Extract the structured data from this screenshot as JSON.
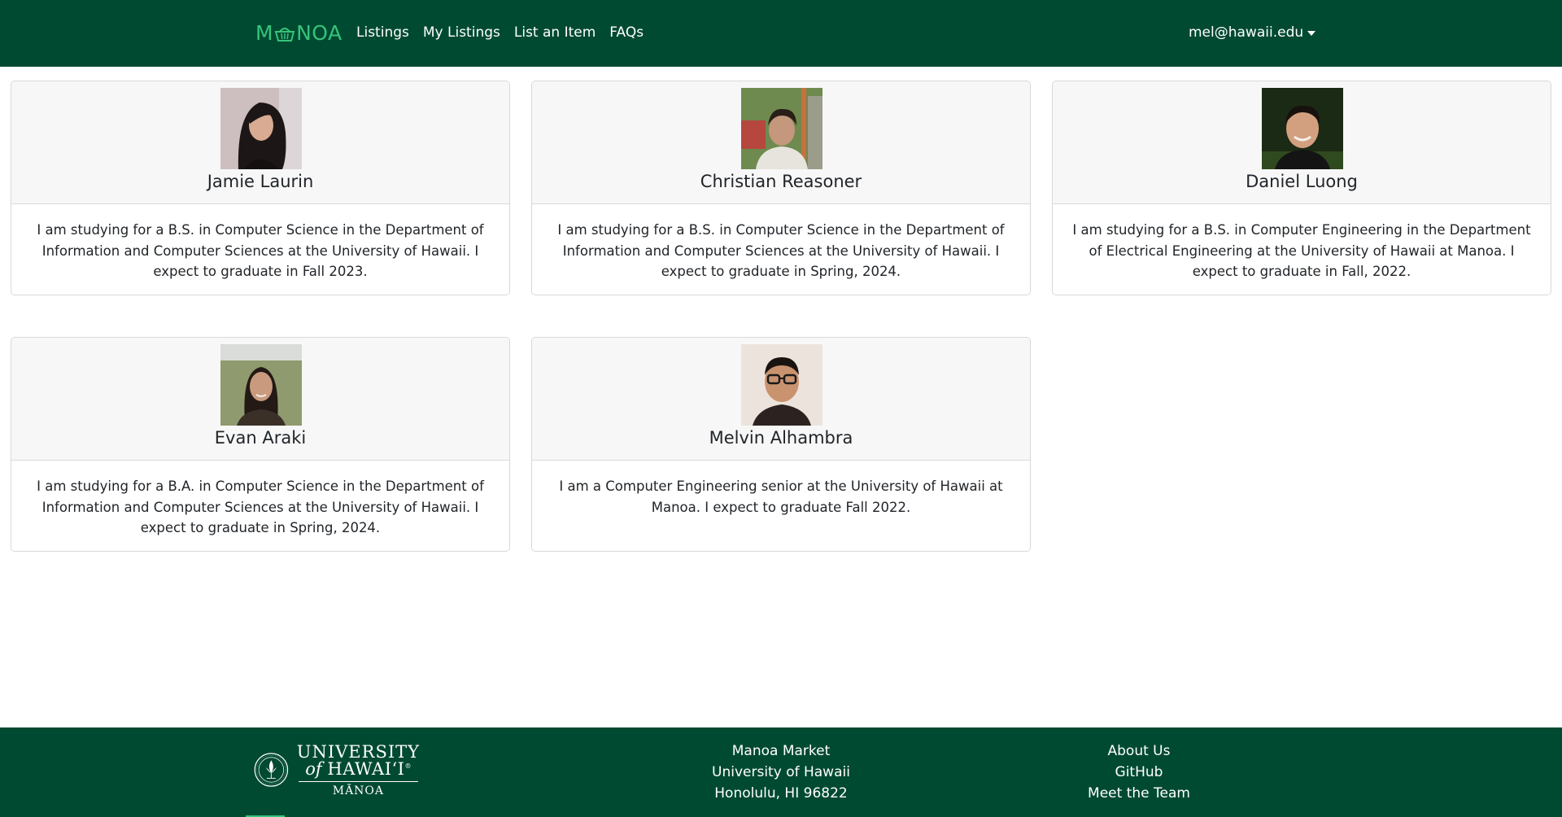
{
  "navbar": {
    "brand_left": "M",
    "brand_right": "NOA",
    "brand_icon": "basket-icon",
    "links": [
      "Listings",
      "My Listings",
      "List an Item",
      "FAQs"
    ],
    "user_email": "mel@hawaii.edu",
    "brand_color": "#35c47a",
    "background_color": "#004a31"
  },
  "team": [
    {
      "name": "Jamie Laurin",
      "bio": "I am studying for a B.S. in Computer Science in the Department of Information and Computer Sciences at the University of Hawaii. I expect to graduate in Fall 2023."
    },
    {
      "name": "Christian Reasoner",
      "bio": "I am studying for a B.S. in Computer Science in the Department of Information and Computer Sciences at the University of Hawaii. I expect to graduate in Spring, 2024."
    },
    {
      "name": "Daniel Luong",
      "bio": "I am studying for a B.S. in Computer Engineering in the Department of Electrical Engineering at the University of Hawaii at Manoa. I expect to graduate in Fall, 2022."
    },
    {
      "name": "Evan Araki",
      "bio": "I am studying for a B.A. in Computer Science in the Department of Information and Computer Sciences at the University of Hawaii. I expect to graduate in Spring, 2024."
    },
    {
      "name": "Melvin Alhambra",
      "bio": "I am a Computer Engineering senior at the University of Hawaii at Manoa. I expect to graduate Fall 2022."
    }
  ],
  "footer": {
    "logo": {
      "line1": "UNIVERSITY",
      "line2_of": "of",
      "line2_name": "HAWAIʻI",
      "line2_mark": "®",
      "line3": "MĀNOA"
    },
    "address": [
      "Manoa Market",
      "University of Hawaii",
      "Honolulu, HI 96822"
    ],
    "links": [
      "About Us",
      "GitHub",
      "Meet the Team"
    ]
  }
}
